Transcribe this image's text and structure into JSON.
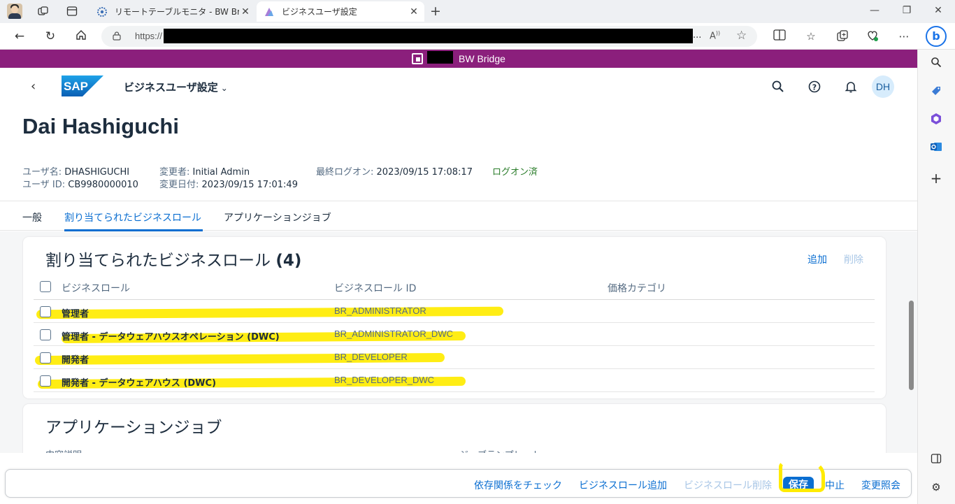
{
  "browser": {
    "tabs": [
      {
        "title": "リモートテーブルモニタ - BW Bridge (S"
      },
      {
        "title": "ビジネスユーザ設定"
      }
    ],
    "url_prefix": "https://",
    "url_ellipsis": "...",
    "reader_icon": "A"
  },
  "banner": {
    "text": "BW Bridge",
    "color": "#8b1f7c"
  },
  "shell": {
    "app_title": "ビジネスユーザ設定",
    "avatar": "DH"
  },
  "header": {
    "name": "Dai Hashiguchi",
    "username_label": "ユーザ名:",
    "username": "DHASHIGUCHI",
    "userid_label": "ユーザ ID:",
    "userid": "CB9980000010",
    "changed_by_label": "変更者:",
    "changed_by": "Initial Admin",
    "changed_on_label": "変更日付:",
    "changed_on": "2023/09/15 17:01:49",
    "last_logon_label": "最終ログオン:",
    "last_logon": "2023/09/15 17:08:17",
    "logon_status": "ログオン済"
  },
  "tabs": [
    {
      "label": "一般"
    },
    {
      "label": "割り当てられたビジネスロール"
    },
    {
      "label": "アプリケーションジョブ"
    }
  ],
  "roles_card": {
    "title": "割り当てられたビジネスロール",
    "count": "(4)",
    "add_label": "追加",
    "delete_label": "削除",
    "columns": [
      "ビジネスロール",
      "ビジネスロール ID",
      "価格カテゴリ"
    ],
    "rows": [
      {
        "name": "管理者",
        "id": "BR_ADMINISTRATOR"
      },
      {
        "name": "管理者 - データウェアハウスオペレーション (DWC)",
        "id": "BR_ADMINISTRATOR_DWC"
      },
      {
        "name": "開発者",
        "id": "BR_DEVELOPER"
      },
      {
        "name": "開発者 - データウェアハウス (DWC)",
        "id": "BR_DEVELOPER_DWC"
      }
    ]
  },
  "jobs_card": {
    "title": "アプリケーションジョブ",
    "columns": [
      "内容説明",
      "ジョブテンプレート"
    ]
  },
  "footer": {
    "check_deps": "依存関係をチェック",
    "add_role": "ビジネスロール追加",
    "delete_role": "ビジネスロール削除",
    "save": "保存",
    "cancel": "中止",
    "change_history": "変更照会"
  },
  "colors": {
    "accent": "#0a6ed1",
    "highlight": "#ffeb00",
    "status_ok": "#2b7d2b"
  }
}
